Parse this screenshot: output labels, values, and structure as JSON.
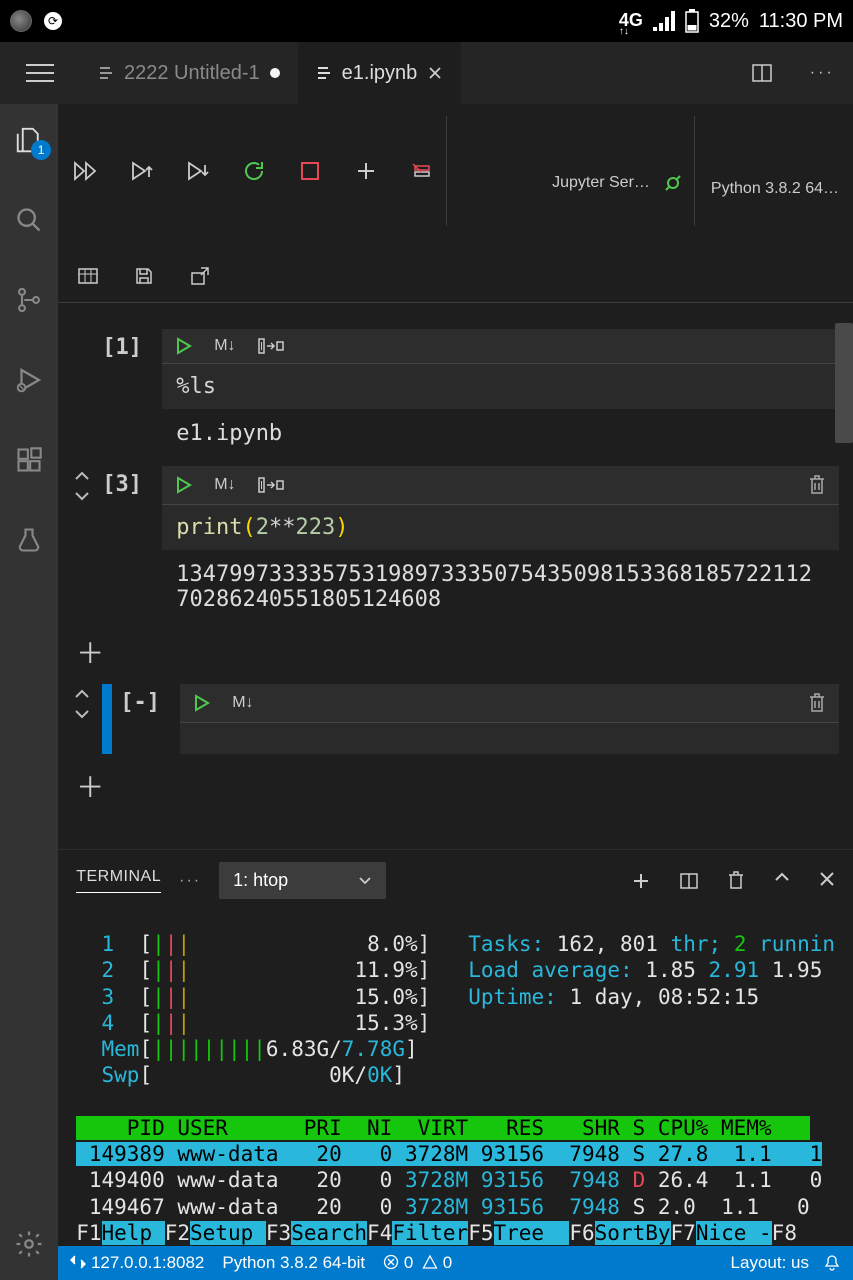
{
  "status_top": {
    "network": "4G",
    "battery": "32%",
    "time": "11:30 PM"
  },
  "tabs": [
    {
      "label": "2222  Untitled-1",
      "modified": true,
      "active": false
    },
    {
      "label": "e1.ipynb",
      "modified": false,
      "active": true
    }
  ],
  "toolbar": {
    "kernel_server": "Jupyter Ser…",
    "kernel_python": "Python 3.8.2 64…"
  },
  "cells": [
    {
      "prompt": "[1]",
      "code_plain": "%ls",
      "output": "e1.ipynb",
      "show_arrows": false,
      "show_expand": true,
      "show_trash": false
    },
    {
      "prompt": "[3]",
      "code_html": "<span class='code-keyword'>print</span><span class='code-paren'>(</span><span class='code-num'>2</span><span class='code-op'>**</span><span class='code-num'>223</span><span class='code-paren'>)</span>",
      "output": "13479973333575319897333507543509815336818572211270286240551805124608",
      "show_arrows": true,
      "show_expand": true,
      "show_trash": true
    },
    {
      "prompt": "[-]",
      "code_html": "",
      "output": "",
      "show_arrows": true,
      "show_expand": false,
      "show_trash": true,
      "collapsed_bar": true
    }
  ],
  "terminal": {
    "tab_label": "TERMINAL",
    "select_label": "1: htop",
    "htop": {
      "cpus": [
        {
          "n": "1",
          "pct": "8.0%"
        },
        {
          "n": "2",
          "pct": "11.9%"
        },
        {
          "n": "3",
          "pct": "15.0%"
        },
        {
          "n": "4",
          "pct": "15.3%"
        }
      ],
      "mem_label": "Mem",
      "mem_used": "6.83G",
      "mem_total": "7.78G",
      "swp_label": "Swp",
      "swp_used": "0K",
      "swp_total": "0K",
      "tasks_label": "Tasks:",
      "tasks": "162,",
      "threads": "801",
      "thr_label": "thr;",
      "running": "2",
      "running_label": "runnin",
      "load_label": "Load average:",
      "load1": "1.85",
      "load2": "2.91",
      "load3": "1.95",
      "uptime_label": "Uptime:",
      "uptime_val": "1 day, 08:52:15",
      "header": "    PID USER      PRI  NI  VIRT   RES   SHR S CPU% MEM%   ",
      "rows": [
        {
          "pid": "149389",
          "user": "www-data",
          "pri": "20",
          "ni": "0",
          "virt": "3728M",
          "res": "93156",
          "shr": "7948",
          "s": "S",
          "cpu": "27.8",
          "mem": "1.1",
          "tail": "1",
          "selected": true
        },
        {
          "pid": "149400",
          "user": "www-data",
          "pri": "20",
          "ni": "0",
          "virt": "3728M",
          "res": "93156",
          "shr": "7948",
          "s": "D",
          "cpu": "26.4",
          "mem": "1.1",
          "tail": "0",
          "selected": false
        },
        {
          "pid": "149467",
          "user": "www-data",
          "pri": "20",
          "ni": "0",
          "virt": "3728M",
          "res": "93156",
          "shr": "7948",
          "s": "S",
          "cpu": "2.0",
          "mem": "1.1",
          "tail": "0",
          "selected": false
        }
      ],
      "fn_keys": [
        {
          "k": "F1",
          "l": "Help "
        },
        {
          "k": "F2",
          "l": "Setup "
        },
        {
          "k": "F3",
          "l": "Search"
        },
        {
          "k": "F4",
          "l": "Filter"
        },
        {
          "k": "F5",
          "l": "Tree  "
        },
        {
          "k": "F6",
          "l": "SortBy"
        },
        {
          "k": "F7",
          "l": "Nice -"
        },
        {
          "k": "F8",
          "l": ""
        }
      ]
    }
  },
  "bottom": {
    "remote": "127.0.0.1:8082",
    "python": "Python 3.8.2 64-bit",
    "errors": "0",
    "warnings": "0",
    "layout": "Layout: us"
  }
}
